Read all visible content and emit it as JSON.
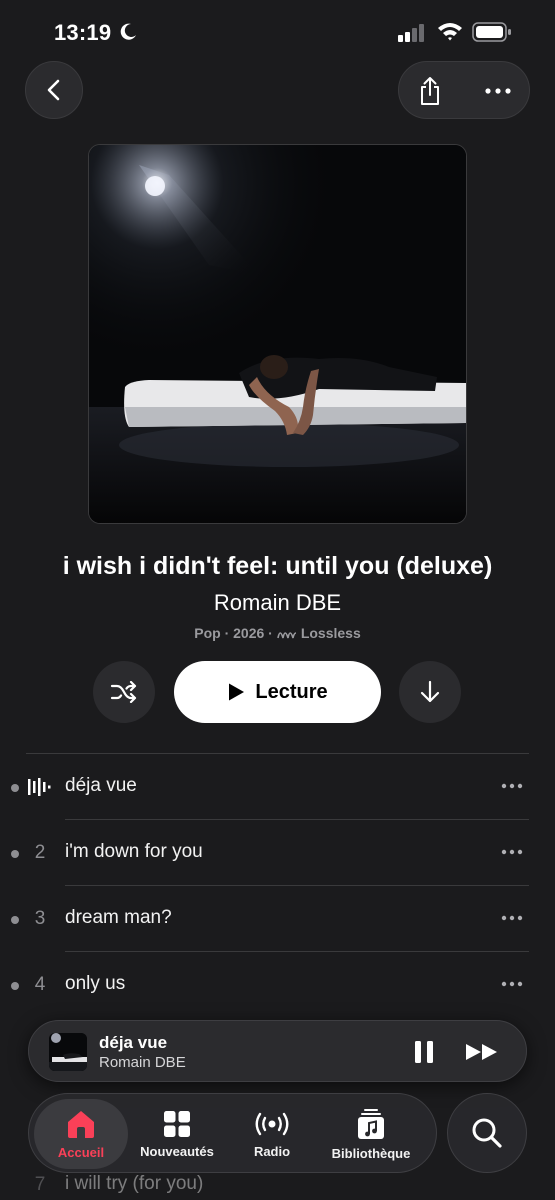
{
  "status_bar": {
    "time": "13:19"
  },
  "album": {
    "title": "i wish i didn't feel: until you (deluxe)",
    "artist": "Romain DBE",
    "meta_prefix": "Pop · 2026 ·",
    "meta_lossless": "Lossless"
  },
  "controls": {
    "play_label": "Lecture"
  },
  "tracks": [
    {
      "number": "",
      "title": "déja vue",
      "playing": true
    },
    {
      "number": "2",
      "title": "i'm down for you"
    },
    {
      "number": "3",
      "title": "dream man?"
    },
    {
      "number": "4",
      "title": "only us"
    }
  ],
  "peek_track": {
    "number": "7",
    "title": "i will try (for you)"
  },
  "mini_player": {
    "title": "déja vue",
    "artist": "Romain DBE"
  },
  "tab_bar": {
    "tabs": [
      {
        "label": "Accueil",
        "icon": "home-icon",
        "active": true
      },
      {
        "label": "Nouveautés",
        "icon": "grid-icon"
      },
      {
        "label": "Radio",
        "icon": "radio-icon"
      },
      {
        "label": "Bibliothèque",
        "icon": "library-icon"
      }
    ],
    "search_icon": "search-icon"
  },
  "colors": {
    "accent": "#fa4058",
    "background": "#1b1b1d",
    "play_button": "#ffffff"
  }
}
